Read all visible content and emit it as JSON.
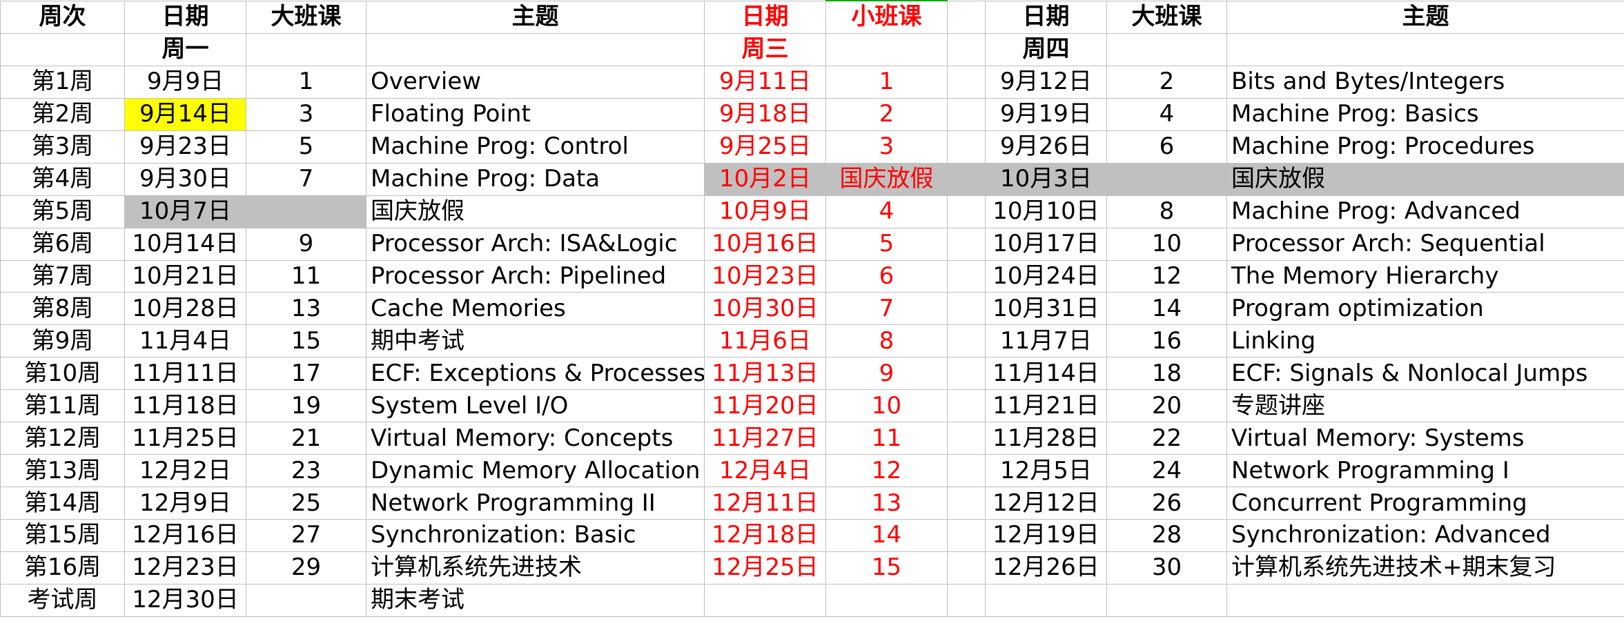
{
  "header": {
    "week": "周次",
    "date1": "日期",
    "lecture1": "大班课",
    "topic1": "主题",
    "date2": "日期",
    "seminar": "小班课",
    "date3": "日期",
    "lecture2": "大班课",
    "topic2": "主题"
  },
  "subheader": {
    "day1": "周一",
    "day2": "周三",
    "day3": "周四"
  },
  "rows": [
    {
      "week": "第1周",
      "mon_date": "9月9日",
      "mon_no": "1",
      "mon_topic": "Overview",
      "wed_date": "9月11日",
      "wed_no": "1",
      "thu_date": "9月12日",
      "thu_no": "2",
      "thu_topic": "Bits and Bytes/Integers"
    },
    {
      "week": "第2周",
      "mon_date": "9月14日",
      "mon_no": "3",
      "mon_topic": "Floating Point",
      "wed_date": "9月18日",
      "wed_no": "2",
      "thu_date": "9月19日",
      "thu_no": "4",
      "thu_topic": "Machine Prog: Basics"
    },
    {
      "week": "第3周",
      "mon_date": "9月23日",
      "mon_no": "5",
      "mon_topic": "Machine Prog: Control",
      "wed_date": "9月25日",
      "wed_no": "3",
      "thu_date": "9月26日",
      "thu_no": "6",
      "thu_topic": "Machine Prog: Procedures"
    },
    {
      "week": "第4周",
      "mon_date": "9月30日",
      "mon_no": "7",
      "mon_topic": "Machine Prog: Data",
      "wed_date": "10月2日",
      "wed_no": "国庆放假",
      "thu_date": "10月3日",
      "thu_no": "",
      "thu_topic": "国庆放假"
    },
    {
      "week": "第5周",
      "mon_date": "10月7日",
      "mon_no": "",
      "mon_topic": "国庆放假",
      "wed_date": "10月9日",
      "wed_no": "4",
      "thu_date": "10月10日",
      "thu_no": "8",
      "thu_topic": "Machine Prog: Advanced"
    },
    {
      "week": "第6周",
      "mon_date": "10月14日",
      "mon_no": "9",
      "mon_topic": "Processor Arch: ISA&Logic",
      "wed_date": "10月16日",
      "wed_no": "5",
      "thu_date": "10月17日",
      "thu_no": "10",
      "thu_topic": "Processor Arch: Sequential"
    },
    {
      "week": "第7周",
      "mon_date": "10月21日",
      "mon_no": "11",
      "mon_topic": "Processor Arch: Pipelined",
      "wed_date": "10月23日",
      "wed_no": "6",
      "thu_date": "10月24日",
      "thu_no": "12",
      "thu_topic": "The Memory Hierarchy"
    },
    {
      "week": "第8周",
      "mon_date": "10月28日",
      "mon_no": "13",
      "mon_topic": "Cache Memories",
      "wed_date": "10月30日",
      "wed_no": "7",
      "thu_date": "10月31日",
      "thu_no": "14",
      "thu_topic": "Program optimization"
    },
    {
      "week": "第9周",
      "mon_date": "11月4日",
      "mon_no": "15",
      "mon_topic": "期中考试",
      "wed_date": "11月6日",
      "wed_no": "8",
      "thu_date": "11月7日",
      "thu_no": "16",
      "thu_topic": "Linking"
    },
    {
      "week": "第10周",
      "mon_date": "11月11日",
      "mon_no": "17",
      "mon_topic": "ECF: Exceptions & Processes",
      "wed_date": "11月13日",
      "wed_no": "9",
      "thu_date": "11月14日",
      "thu_no": "18",
      "thu_topic": "ECF: Signals & Nonlocal Jumps"
    },
    {
      "week": "第11周",
      "mon_date": "11月18日",
      "mon_no": "19",
      "mon_topic": "System Level I/O",
      "wed_date": "11月20日",
      "wed_no": "10",
      "thu_date": "11月21日",
      "thu_no": "20",
      "thu_topic": "专题讲座"
    },
    {
      "week": "第12周",
      "mon_date": "11月25日",
      "mon_no": "21",
      "mon_topic": "Virtual Memory: Concepts",
      "wed_date": "11月27日",
      "wed_no": "11",
      "thu_date": "11月28日",
      "thu_no": "22",
      "thu_topic": "Virtual Memory: Systems"
    },
    {
      "week": "第13周",
      "mon_date": "12月2日",
      "mon_no": "23",
      "mon_topic": "Dynamic Memory Allocation",
      "wed_date": "12月4日",
      "wed_no": "12",
      "thu_date": "12月5日",
      "thu_no": "24",
      "thu_topic": "Network Programming I"
    },
    {
      "week": "第14周",
      "mon_date": "12月9日",
      "mon_no": "25",
      "mon_topic": "Network Programming II",
      "wed_date": "12月11日",
      "wed_no": "13",
      "thu_date": "12月12日",
      "thu_no": "26",
      "thu_topic": "Concurrent Programming"
    },
    {
      "week": "第15周",
      "mon_date": "12月16日",
      "mon_no": "27",
      "mon_topic": "Synchronization: Basic",
      "wed_date": "12月18日",
      "wed_no": "14",
      "thu_date": "12月19日",
      "thu_no": "28",
      "thu_topic": "Synchronization: Advanced"
    },
    {
      "week": "第16周",
      "mon_date": "12月23日",
      "mon_no": "29",
      "mon_topic": "计算机系统先进技术",
      "wed_date": "12月25日",
      "wed_no": "15",
      "thu_date": "12月26日",
      "thu_no": "30",
      "thu_topic": "计算机系统先进技术+期末复习"
    },
    {
      "week": "考试周",
      "mon_date": "12月30日",
      "mon_no": "",
      "mon_topic": "期末考试",
      "wed_date": "",
      "wed_no": "",
      "thu_date": "",
      "thu_no": "",
      "thu_topic": ""
    }
  ],
  "highlights": {
    "selected_date_bg": "#ffff00",
    "holiday_bg": "#c0c0c0",
    "wednesday_text": "#ff0000"
  }
}
